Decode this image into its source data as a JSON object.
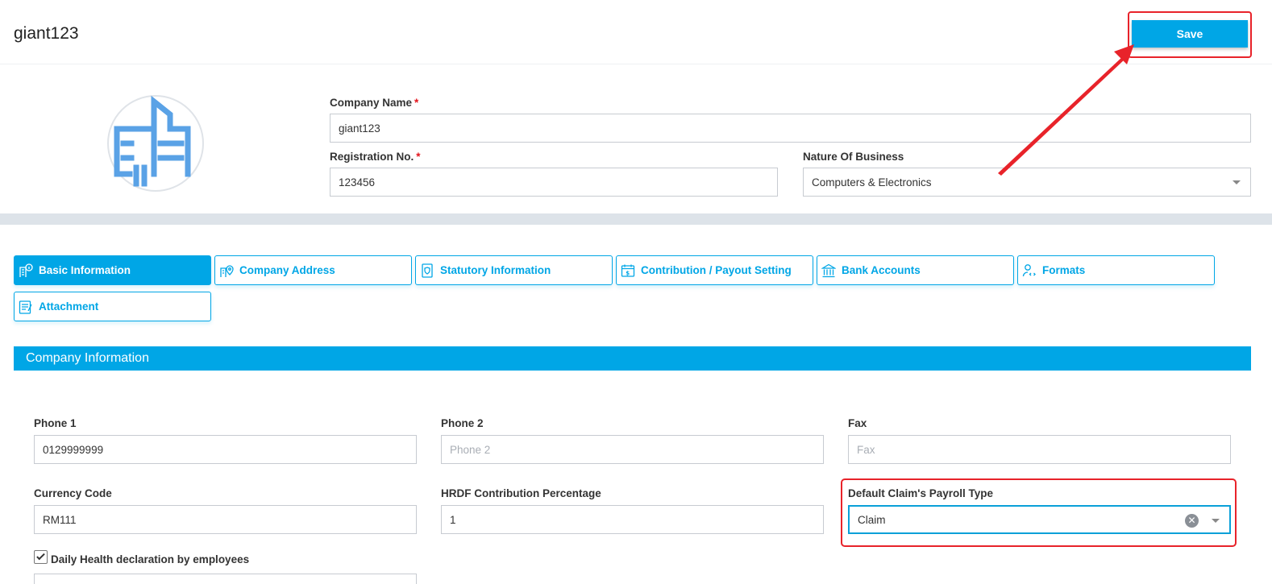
{
  "header": {
    "title": "giant123",
    "save_label": "Save"
  },
  "company": {
    "name_label": "Company Name",
    "name_value": "giant123",
    "reg_label": "Registration No.",
    "reg_value": "123456",
    "nature_label": "Nature Of Business",
    "nature_value": "Computers & Electronics",
    "required_mark": "*"
  },
  "tabs": [
    {
      "label": "Basic Information",
      "icon": "info-building-icon"
    },
    {
      "label": "Company Address",
      "icon": "location-building-icon"
    },
    {
      "label": "Statutory Information",
      "icon": "shield-document-icon"
    },
    {
      "label": "Contribution / Payout Setting",
      "icon": "dollar-calendar-icon"
    },
    {
      "label": "Bank Accounts",
      "icon": "bank-icon"
    },
    {
      "label": "Formats",
      "icon": "user-code-icon"
    },
    {
      "label": "Attachment",
      "icon": "attachment-document-icon"
    }
  ],
  "section": {
    "title": "Company Information"
  },
  "fields": {
    "phone1_label": "Phone 1",
    "phone1_value": "0129999999",
    "phone2_label": "Phone 2",
    "phone2_placeholder": "Phone 2",
    "fax_label": "Fax",
    "fax_placeholder": "Fax",
    "currency_label": "Currency Code",
    "currency_value": "RM111",
    "hrdf_label": "HRDF Contribution Percentage",
    "hrdf_value": "1",
    "claim_type_label": "Default Claim's Payroll Type",
    "claim_type_value": "Claim",
    "health_label": "Daily Health declaration by employees",
    "health_checked": true
  },
  "colors": {
    "accent": "#00a6e6",
    "highlight": "#e8232a"
  }
}
